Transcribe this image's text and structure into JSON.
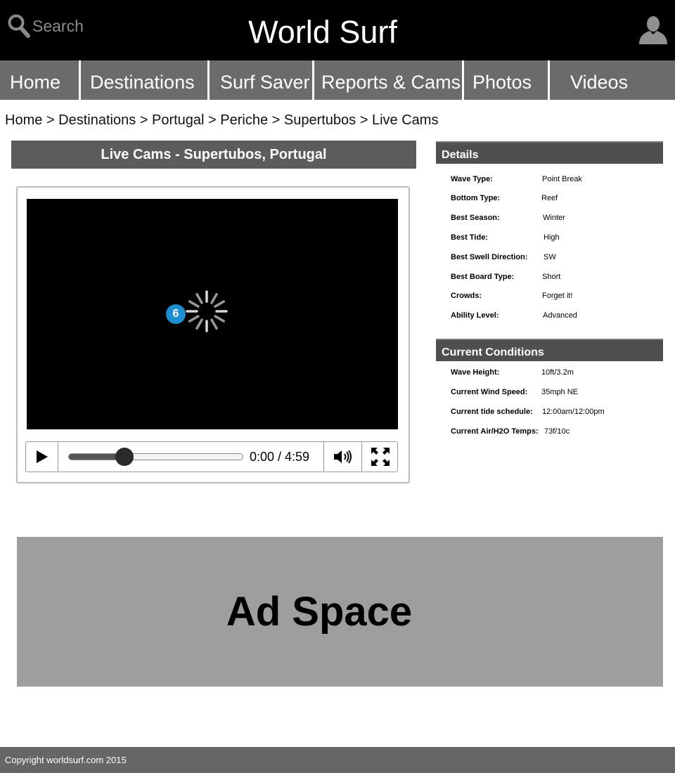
{
  "header": {
    "search_placeholder": "Search",
    "title": "World Surf",
    "search_icon": "magnifier",
    "user_icon": "user-silhouette"
  },
  "nav": {
    "items": [
      "Home",
      "Destinations",
      "Surf Saver",
      "Reports & Cams",
      "Photos",
      "Videos"
    ]
  },
  "breadcrumb": "Home > Destinations > Portugal > Periche > Supertubos > Live Cams",
  "panel_title": "Live Cams - Supertubos, Portugal",
  "player": {
    "badge": "6",
    "current_time": "0:00",
    "duration": "4:59",
    "time_label": "0:00 / 4:59",
    "progress_fraction": 0.32,
    "icons": [
      "play-icon",
      "volume-icon",
      "fullscreen-icon",
      "loading-spinner"
    ]
  },
  "details": {
    "heading": "Details",
    "rows": [
      {
        "label": "Wave Type:",
        "value": "Point Break"
      },
      {
        "label": "Bottom Type:",
        "value": "Reef"
      },
      {
        "label": "Best Season:",
        "value": "Winter"
      },
      {
        "label": "Best Tide:",
        "value": "High"
      },
      {
        "label": "Best Swell Direction:",
        "value": "SW"
      },
      {
        "label": "Best Board Type:",
        "value": "Short"
      },
      {
        "label": "Crowds:",
        "value": "Forget it!"
      },
      {
        "label": "Ability Level:",
        "value": "Advanced"
      }
    ]
  },
  "conditions": {
    "heading": "Current Conditions",
    "rows": [
      {
        "label": "Wave Height:",
        "value": "10ft/3.2m"
      },
      {
        "label": "Current Wind Speed:",
        "value": "35mph NE"
      },
      {
        "label": "Current tide schedule:",
        "value": "12:00am/12:00pm"
      },
      {
        "label": "Current Air/H2O Temps:",
        "value": "73f/10c"
      }
    ]
  },
  "ad": {
    "text": "Ad Space"
  },
  "footer": {
    "copyright": "Copyright worldsurf.com 2015"
  },
  "colors": {
    "header_bg": "#000000",
    "nav_bg": "#6b6b6b",
    "panel_bg": "#5c5c5c",
    "sidebar_head_bg": "#4f4f4f",
    "ad_bg": "#9e9e9e",
    "footer_bg": "#666666",
    "badge": "#1d8fd0"
  }
}
